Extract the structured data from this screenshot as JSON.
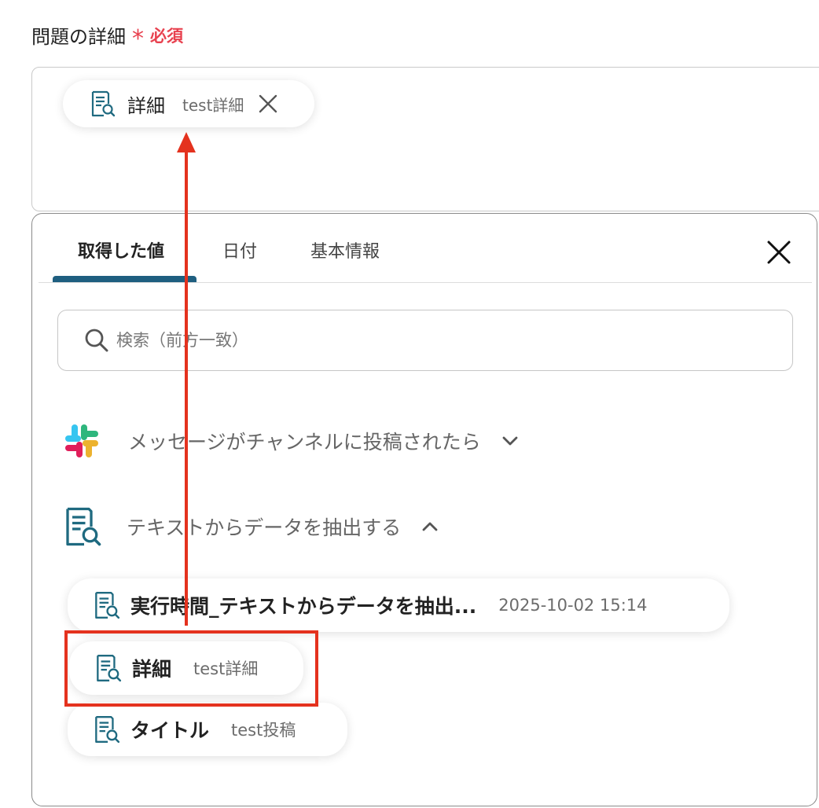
{
  "field": {
    "label": "問題の詳細",
    "asterisk": "*",
    "required": "必須",
    "selected_chip": {
      "icon": "document-search-icon",
      "name": "詳細",
      "value": "test詳細"
    }
  },
  "panel": {
    "tabs": [
      {
        "label": "取得した値",
        "active": true
      },
      {
        "label": "日付",
        "active": false
      },
      {
        "label": "基本情報",
        "active": false
      }
    ],
    "search": {
      "placeholder": "検索（前方一致）",
      "value": ""
    },
    "groups": [
      {
        "icon": "slack-icon",
        "label": "メッセージがチャンネルに投稿されたら",
        "expanded": false
      },
      {
        "icon": "document-search-icon",
        "label": "テキストからデータを抽出する",
        "expanded": true
      }
    ],
    "items": [
      {
        "icon": "document-search-icon",
        "name": "実行時間_テキストからデータを抽出...",
        "value": "2025-10-02 15:14"
      },
      {
        "icon": "document-search-icon",
        "name": "詳細",
        "value": "test詳細"
      },
      {
        "icon": "document-search-icon",
        "name": "タイトル",
        "value": "test投稿"
      }
    ]
  },
  "colors": {
    "accent": "#1f5f80",
    "required": "#e8414f",
    "highlight": "#e4321e",
    "icon": "#1f6a80"
  }
}
